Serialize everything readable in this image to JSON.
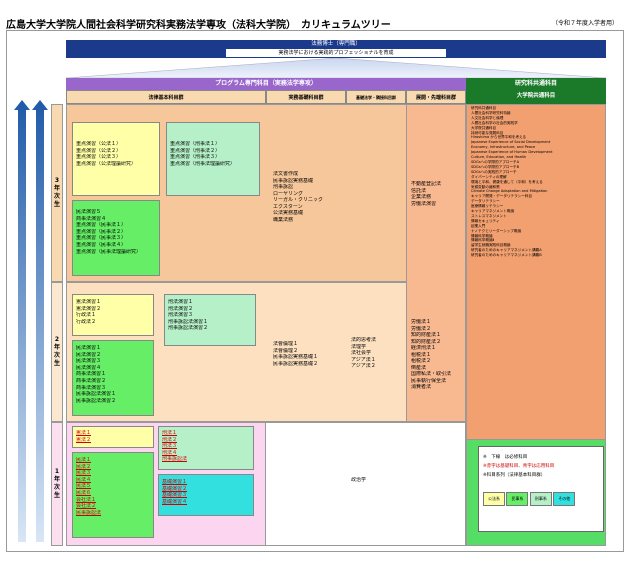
{
  "title": "広島大学大学院人間社会科学研究科実務法学専攻（法科大学院）　カリキュラムツリー",
  "note": "（令和７年度入学者用）",
  "banner": {
    "main": "法務博士（専門職）",
    "sub": "実務法学における実践的プロフェッショナルを育成"
  },
  "headers": {
    "program": "プログラム専門科目（実務法学専攻）",
    "common": "研究科共通科目",
    "univ": "大学院共通科目"
  },
  "subheaders": {
    "basic": "法律基本科目群",
    "practice": "実務基礎科目群",
    "fund": "基礎法学・隣接科目群",
    "adv": "展開・先端科目群"
  },
  "years": {
    "y3": "3年次生",
    "y2": "2年次生",
    "y1": "1年次生"
  },
  "y3": {
    "pub": [
      "重点演習（公法１）",
      "重点演習（公法２）",
      "重点演習（公法３）",
      "重点演習（公法理論研究）"
    ],
    "crim": [
      "重点演習（刑事法１）",
      "重点演習（刑事法２）",
      "重点演習（刑事法３）",
      "重点演習（刑事法理論研究）"
    ],
    "civ": [
      "民法演習５",
      "商事法演習４",
      "重点演習（民事法１）",
      "重点演習（民事法２）",
      "重点演習（民事法３）",
      "重点演習（民事法４）",
      "重点演習（民事法理論研究）"
    ],
    "practice": [
      "法文書作成",
      "民事訴訟実務基礎",
      "刑事訴訟",
      "ローヤリング",
      "リーガル・クリニック",
      "エクスターン",
      "公法実務基礎",
      "職業法務"
    ],
    "adv": [
      "不動産登記法",
      "信託法",
      "企業法務",
      "労働法演習"
    ]
  },
  "y2": {
    "pub": [
      "憲法演習１",
      "憲法演習２",
      "行政法１",
      "行政法２"
    ],
    "crim": [
      "刑法演習１",
      "刑法演習２",
      "刑法演習３",
      "刑事訴訟法演習１",
      "刑事訴訟法演習２"
    ],
    "civ": [
      "民法演習１",
      "民法演習２",
      "民法演習３",
      "民法演習４",
      "商事法演習１",
      "商事法演習２",
      "商事法演習３",
      "民事訴訟法演習１",
      "民事訴訟法演習２"
    ],
    "practice": [
      "法曹倫理１",
      "法曹倫理２",
      "民事訴訟実務基礎１",
      "民事訴訟実務基礎２"
    ],
    "fund": [
      "法的思考法",
      "法理学",
      "法社会学",
      "アジア法１",
      "アジア法２"
    ],
    "adv": [
      "労働法１",
      "労働法２",
      "知的財産法１",
      "知的財産法２",
      "経済刑法１",
      "租税法１",
      "租税法２",
      "倒産法",
      "国際私法・取引法",
      "民事執行保全法",
      "消費者法"
    ]
  },
  "y1": {
    "pub": [
      "憲法１",
      "憲法２"
    ],
    "crim": [
      "刑法１",
      "刑法２",
      "刑法３",
      "刑法４",
      "刑事訴訟法"
    ],
    "civ": [
      "民法１",
      "民法２",
      "民法３",
      "民法４",
      "民法５",
      "民法６",
      "会社法１",
      "会社法２",
      "民事訴訟法"
    ],
    "base": [
      "基礎演習１",
      "基礎演習２",
      "基礎演習３",
      "基礎演習４"
    ],
    "fund": [
      "政治学"
    ]
  },
  "univ_list": [
    "研究科共通科目",
    "人間社会科学研究科特論",
    "人文社会科学と倫理",
    "人間社会科学の社会的実践学",
    "大学院共通科目",
    "持続可能な発展科目",
    "Hiroshima から世界平和を考える",
    "Japanese Experience of Social Development",
    "Economy, Infrastructure, and Peace",
    "Japanese Experience of Human Development",
    "Culture, Education, and Health",
    "SDGsへの学際的アプローチA",
    "SDGsへの学際的アプローチB",
    "SDGsへの実践的アプローチ",
    "ダイバーシティの理解",
    "環境と平和、健康を通して（平和）を考える",
    "気候変動の緩和策",
    "Climate Change Adaptation and Mitigation",
    "キャリア開発・データリテラシー科目",
    "データリテラシー",
    "医療情報リテラシー",
    "キャリアマネジメント概論",
    "ストレスマネジメント",
    "情報セキュリティ",
    "起業入門",
    "ナノテクとリーダーシップ概論",
    "情報科学概論",
    "情報科学概論Ⅱ",
    "留学生就職実践科目概論",
    "研究者のためのキャリアマネジメント講義A",
    "研究者のためのキャリアマネジメント講義B"
  ],
  "legend": {
    "l1": "※　下線　は必修科目",
    "l2": "※赤字は基礎科目、青字は応用科目",
    "l3": "※科目系列（法律基本科目群）",
    "chips": [
      "公法系",
      "民事系",
      "刑事系",
      "その他"
    ],
    "chip_colors": [
      "#ffffa8",
      "#66ee66",
      "#b5f0c8",
      "#33e0e0"
    ]
  }
}
